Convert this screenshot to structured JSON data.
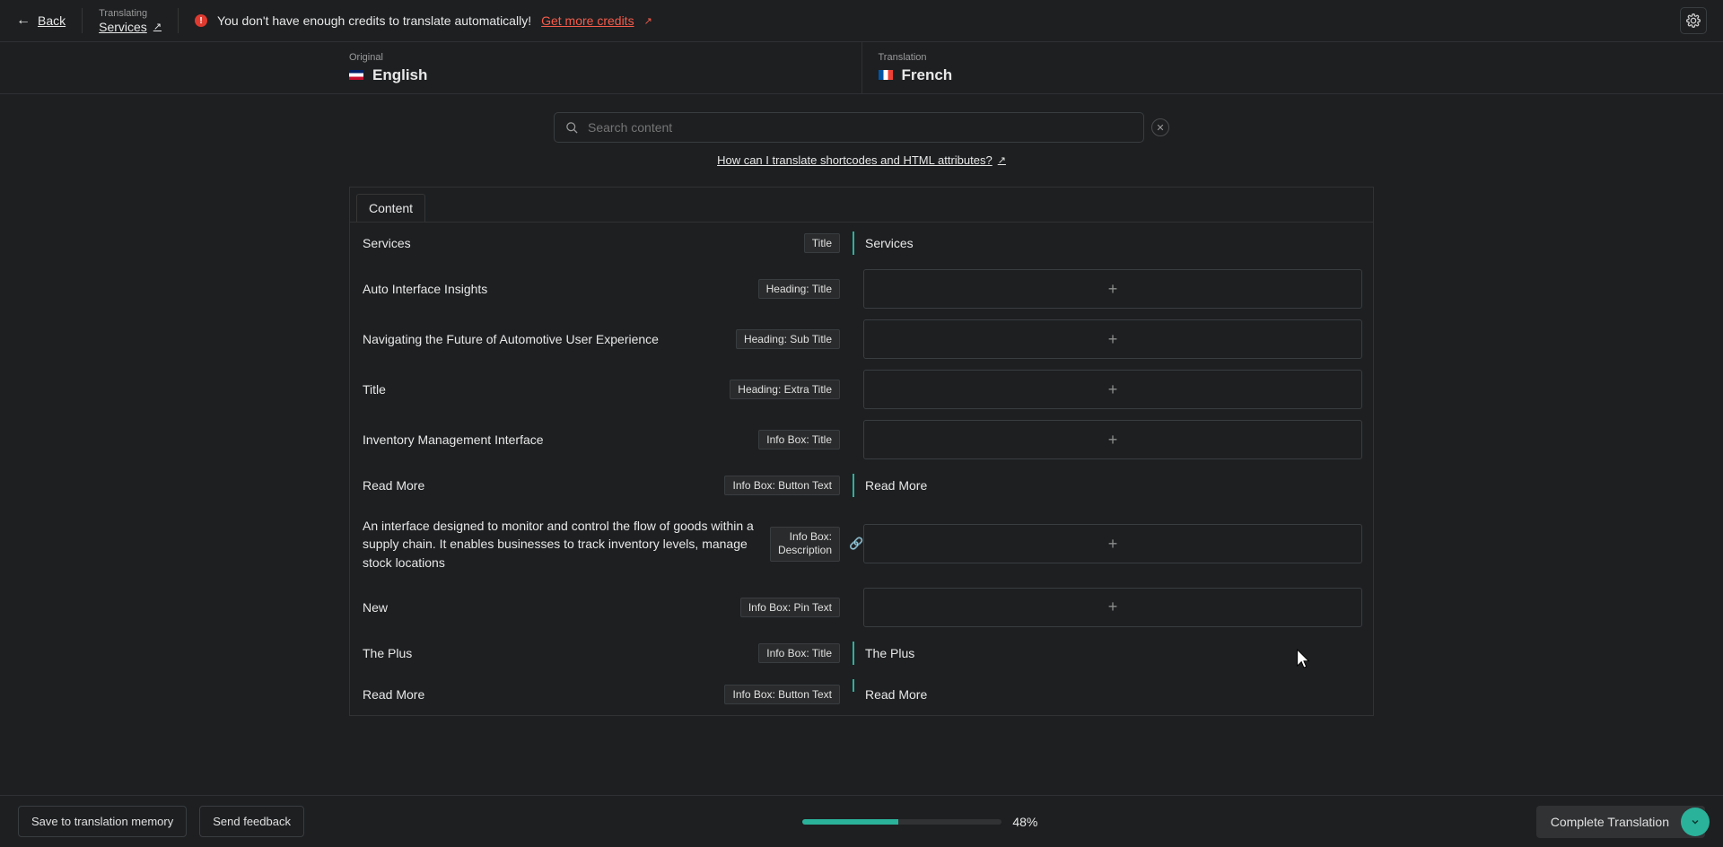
{
  "topbar": {
    "back": "Back",
    "translating_label": "Translating",
    "page_name": "Services",
    "credits_warning": "You don't have enough credits to translate automatically!",
    "get_credits": "Get more credits"
  },
  "lang": {
    "original_label": "Original",
    "original_name": "English",
    "translation_label": "Translation",
    "translation_name": "French"
  },
  "search": {
    "placeholder": "Search content",
    "howto_link": "How can I translate shortcodes and HTML attributes?"
  },
  "panel": {
    "tab": "Content",
    "rows": [
      {
        "orig": "Services",
        "tag": "Title",
        "trans_text": "Services",
        "mode": "text"
      },
      {
        "orig": "Auto Interface Insights",
        "tag": "Heading: Title",
        "mode": "plus"
      },
      {
        "orig": "Navigating the Future of Automotive User Experience",
        "tag": "Heading: Sub Title",
        "mode": "plus"
      },
      {
        "orig": "Title",
        "tag": "Heading: Extra Title",
        "mode": "plus"
      },
      {
        "orig": "Inventory Management Interface",
        "tag": "Info Box: Title",
        "mode": "plus"
      },
      {
        "orig": "Read More",
        "tag": "Info Box: Button Text",
        "trans_text": "Read More",
        "mode": "text"
      },
      {
        "orig": "An interface designed to monitor and control the flow of goods within a supply chain. It enables businesses to track inventory levels, manage stock locations",
        "tag": "Info Box: Description",
        "mode": "plus",
        "link": true
      },
      {
        "orig": "New",
        "tag": "Info Box: Pin Text",
        "mode": "plus"
      },
      {
        "orig": "The Plus",
        "tag": "Info Box: Title",
        "trans_text": "The Plus",
        "mode": "text"
      },
      {
        "orig": "Read More",
        "tag": "Info Box: Button Text",
        "trans_text": "Read More",
        "mode": "text_short"
      }
    ]
  },
  "footer": {
    "save_memory": "Save to translation memory",
    "send_feedback": "Send feedback",
    "progress_pct": 48,
    "progress_label": "48%",
    "complete": "Complete Translation"
  }
}
